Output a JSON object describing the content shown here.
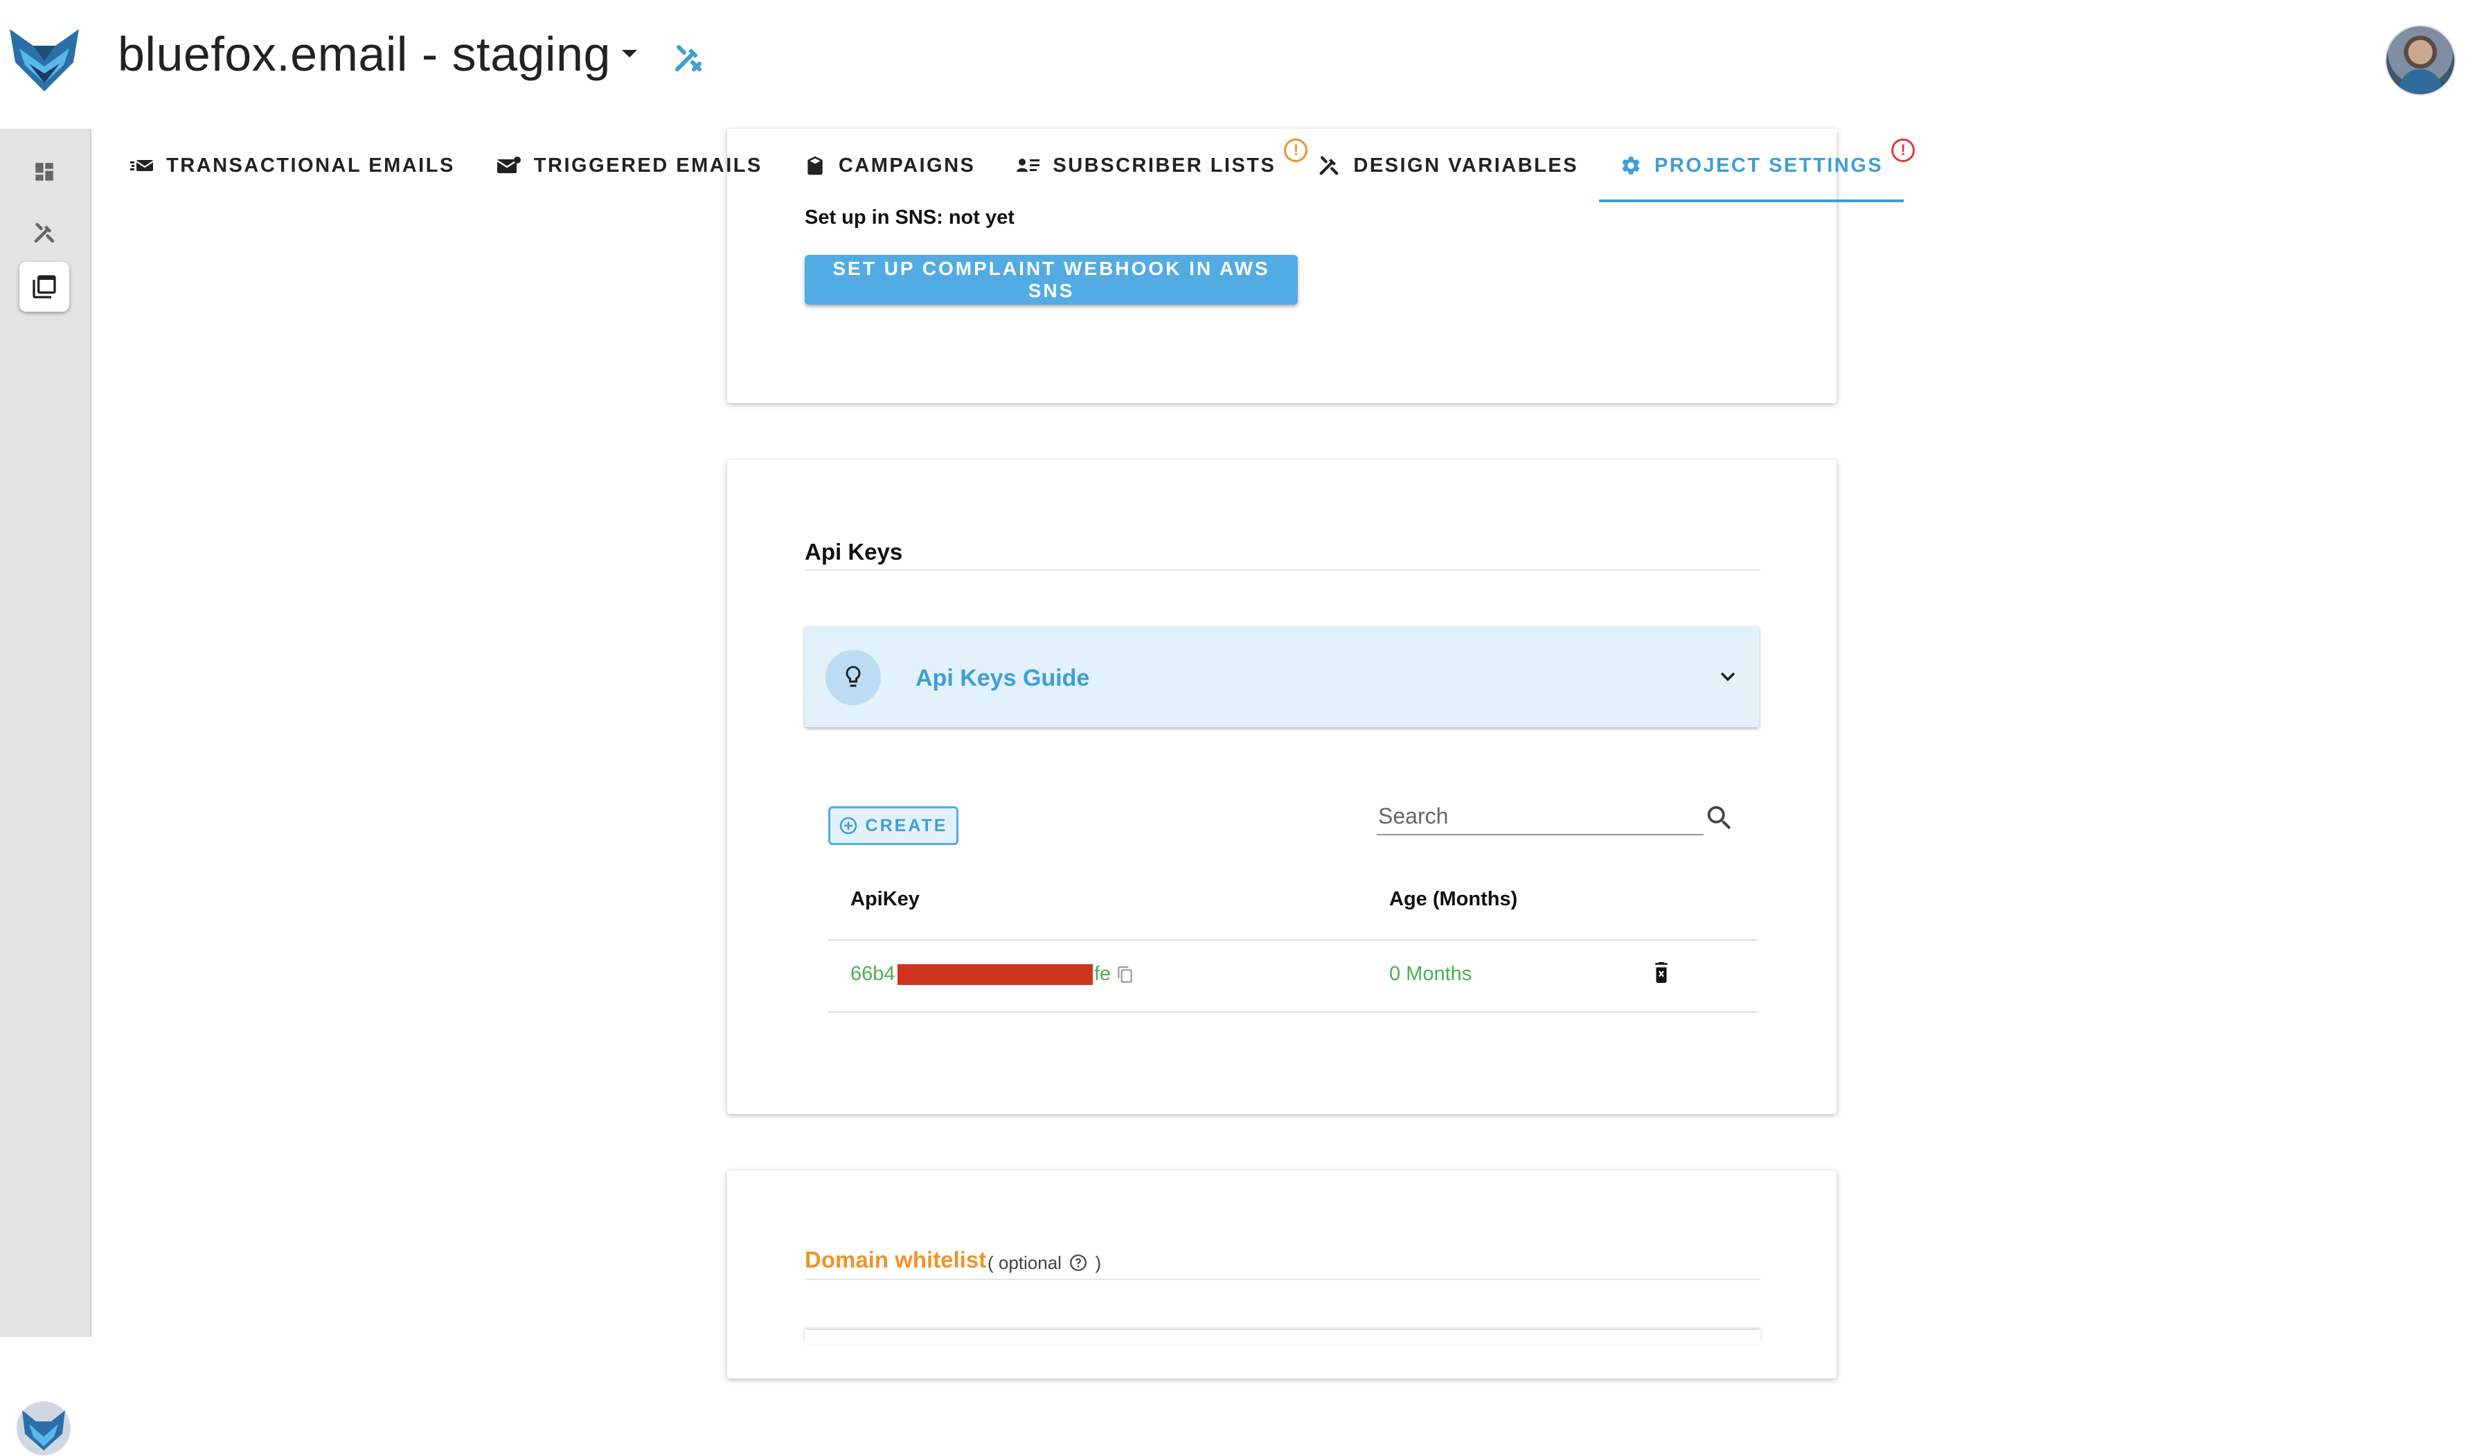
{
  "header": {
    "project_title": "bluefox.email - staging"
  },
  "tabs": [
    {
      "label": "Transactional Emails",
      "icon": "transactional-email-icon",
      "warning": false
    },
    {
      "label": "Triggered Emails",
      "icon": "triggered-email-icon",
      "warning": false
    },
    {
      "label": "Campaigns",
      "icon": "campaign-icon",
      "warning": false
    },
    {
      "label": "Subscriber Lists",
      "icon": "subscriber-list-icon",
      "warning": true,
      "warning_color": "#f0932b"
    },
    {
      "label": "Design Variables",
      "icon": "design-tools-icon",
      "warning": false
    },
    {
      "label": "Project Settings",
      "icon": "settings-gear-icon",
      "warning": true,
      "warning_color": "#e53935",
      "active": true
    }
  ],
  "colors": {
    "accent": "#3d9fd4",
    "button": "#52ace3",
    "success": "#4caf50",
    "warning_orange": "#f0932b",
    "warning_red": "#e53935",
    "redaction": "#d0341f"
  },
  "sns_card": {
    "status_text": "Set up in SNS: not yet",
    "button_label": "Set up complaint webhook in AWS SNS"
  },
  "api_keys": {
    "title": "Api Keys",
    "guide_label": "Api Keys Guide",
    "create_label": "Create",
    "search_placeholder": "Search",
    "columns": [
      "ApiKey",
      "Age (Months)"
    ],
    "rows": [
      {
        "key_prefix": "66b4",
        "key_suffix": "fe",
        "age": "0 Months"
      }
    ]
  },
  "domain_whitelist": {
    "title": "Domain whitelist",
    "optional_open": "( optional",
    "optional_close": ")"
  },
  "warning_mark": "!"
}
